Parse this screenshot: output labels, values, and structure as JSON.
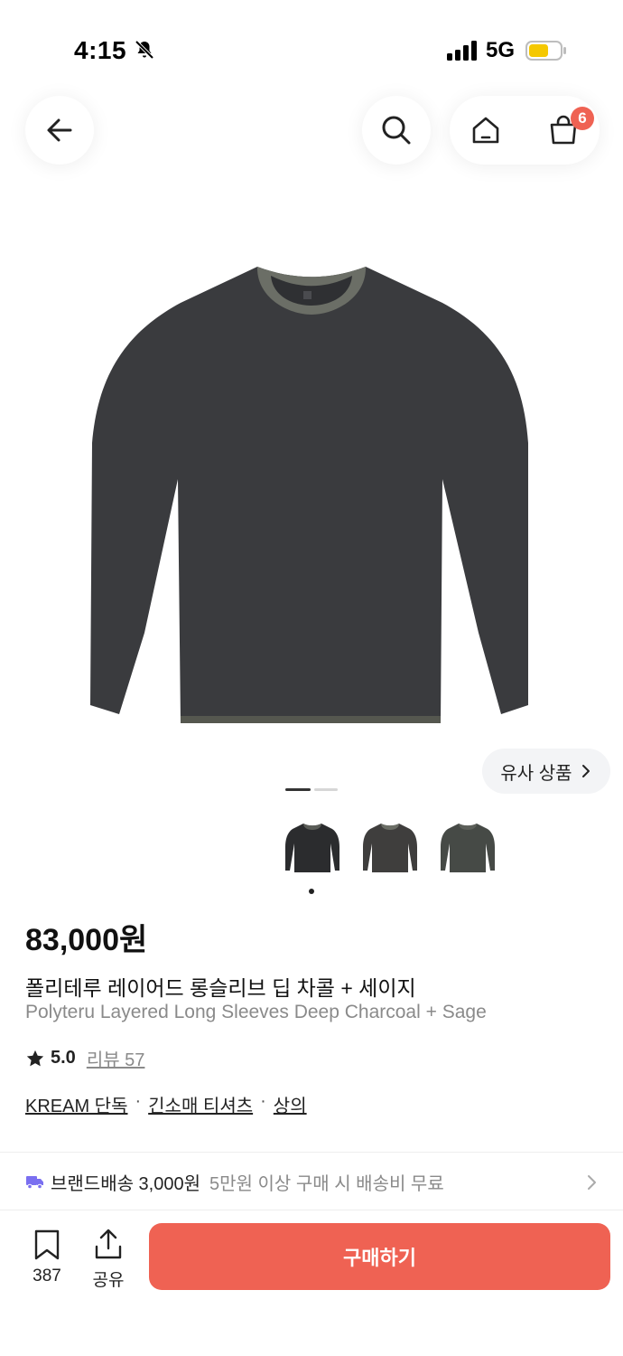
{
  "status_bar": {
    "time": "4:15",
    "network": "5G"
  },
  "header": {
    "cart_count": "6"
  },
  "gallery": {
    "similar_label": "유사 상품"
  },
  "product": {
    "price": "83,000원",
    "name_ko": "폴리테루 레이어드 롱슬리브 딥 차콜 + 세이지",
    "name_en": "Polyteru Layered Long Sleeves Deep Charcoal + Sage",
    "rating": "5.0",
    "review_label": "리뷰 57",
    "breadcrumbs": [
      "KREAM 단독",
      "긴소매 티셔츠",
      "상의"
    ],
    "separator": "·"
  },
  "shipping": {
    "label": "브랜드배송 3,000원",
    "note": "5만원 이상 구매 시 배송비 무료"
  },
  "bottom_bar": {
    "bookmark_count": "387",
    "share_label": "공유",
    "buy_label": "구매하기"
  },
  "colors": {
    "accent": "#ef6253",
    "shirt": "#3a3b3e",
    "collar": "#6b6e66"
  }
}
